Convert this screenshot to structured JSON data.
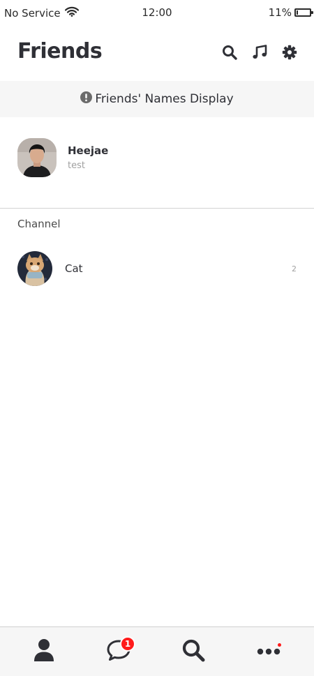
{
  "status_bar": {
    "carrier": "No Service",
    "time": "12:00",
    "battery": "11%",
    "battery_level": 0.11
  },
  "header": {
    "title": "Friends",
    "icons": [
      "search-icon",
      "music-icon",
      "gear-icon"
    ]
  },
  "notice": {
    "icon": "exclamation-circle-icon",
    "text": "Friends' Names Display"
  },
  "friends": [
    {
      "name": "Heejae",
      "status": "test"
    }
  ],
  "channel_section": {
    "label": "Channel",
    "items": [
      {
        "name": "Cat",
        "count": "2"
      }
    ]
  },
  "tab_bar": {
    "tabs": [
      {
        "icon": "person-icon"
      },
      {
        "icon": "chat-bubble-icon",
        "badge": "1"
      },
      {
        "icon": "search-icon"
      },
      {
        "icon": "more-icon",
        "dot": true
      }
    ]
  },
  "colors": {
    "icon": "#2f3036",
    "badge": "#ff1b1b",
    "notice_bg": "#f6f6f6"
  }
}
